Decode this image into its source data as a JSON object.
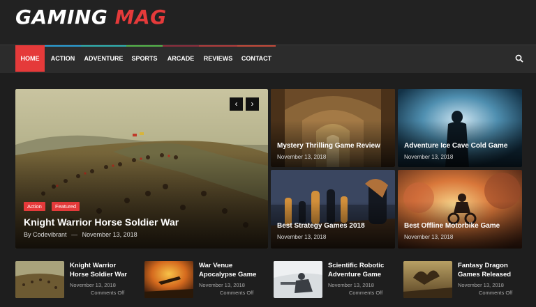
{
  "site": {
    "logo_white": "GAMING",
    "logo_red": "MAG",
    "accent": "#e53a3a"
  },
  "nav": {
    "items": [
      {
        "label": "HOME",
        "color": "#e53a3a"
      },
      {
        "label": "ACTION",
        "color": "#2a9fd6"
      },
      {
        "label": "ADVENTURE",
        "color": "#2fb2b2"
      },
      {
        "label": "SPORTS",
        "color": "#55b54a"
      },
      {
        "label": "ARCADE",
        "color": "#8b2d3c"
      },
      {
        "label": "REVIEWS",
        "color": "#b23c3c"
      },
      {
        "label": "CONTACT",
        "color": "#c44a3a"
      }
    ],
    "search_icon": "search-icon"
  },
  "featured": {
    "tags": [
      "Action",
      "Featured"
    ],
    "title": "Knight Warrior Horse Soldier War",
    "author": "By Codevibrant",
    "separator": "—",
    "date": "November 13, 2018",
    "prev_icon": "chevron-left-icon",
    "next_icon": "chevron-right-icon"
  },
  "grid": [
    {
      "title": "Mystery Thrilling Game Review",
      "date": "November 13, 2018"
    },
    {
      "title": "Adventure Ice Cave Cold Game",
      "date": "November 13, 2018"
    },
    {
      "title": "Best Strategy Games 2018",
      "date": "November 13, 2018"
    },
    {
      "title": "Best Offline Motorbike Game",
      "date": "November 13, 2018"
    }
  ],
  "cards": [
    {
      "title_line1": "Knight Warrior",
      "title_line2": "Horse Soldier War",
      "date": "November 13, 2018",
      "comments": "Comments Off"
    },
    {
      "title_line1": "War Venue",
      "title_line2": "Apocalypse Game",
      "date": "November 13, 2018",
      "comments": "Comments Off"
    },
    {
      "title_line1": "Scientific Robotic",
      "title_line2": "Adventure Game",
      "date": "November 13, 2018",
      "comments": "Comments Off"
    },
    {
      "title_line1": "Fantasy Dragon",
      "title_line2": "Games Released",
      "date": "November 13, 2018",
      "comments": "Comments Off"
    }
  ]
}
